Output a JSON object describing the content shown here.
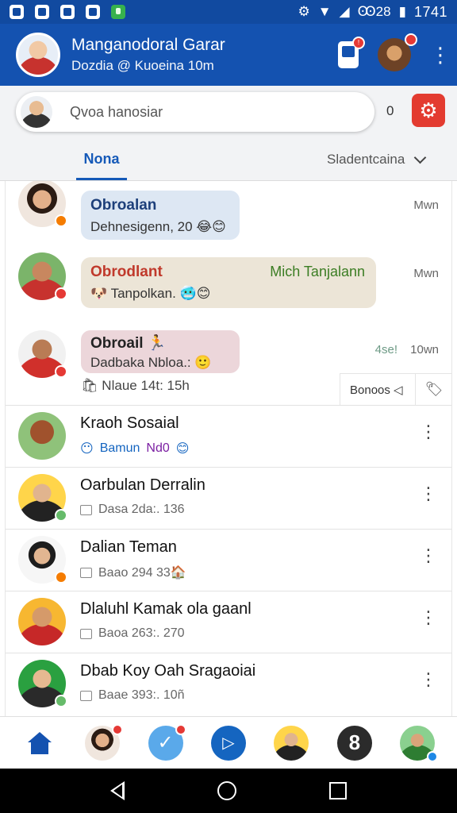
{
  "status_bar": {
    "time": "1741",
    "signal_text": "Ꙭ28"
  },
  "header": {
    "title": "Manganodoral Garar",
    "subtitle": "Dozdia @ Kuoeina 10m",
    "notification_badge": "!",
    "icons": [
      "phone-icon",
      "profile-avatar",
      "more-vert-icon"
    ]
  },
  "search": {
    "placeholder": "Qvoa hanosiar",
    "count": "0"
  },
  "tabs": {
    "active": "Nona",
    "dropdown": "Sladentcaina"
  },
  "feed": {
    "bubbles": [
      {
        "title": "Obroalan",
        "text": "Dehnesigenn, 20 😂😊",
        "time": "Mwn"
      },
      {
        "title": "Obrodlant",
        "alt_title": "Mich Tanjalann",
        "text": "🐶 Tanpolkan. 🥶😊",
        "time": "Mwn"
      },
      {
        "title": "Obroail 🏃",
        "text": "Dadbaka Nbloa.: 🙂",
        "time_alt": "4se!",
        "time": "10wn",
        "sub": "🛍 Nlaue 14t: 15h",
        "chip_label": "Bonoos ◁",
        "chip_icon": "🏷"
      }
    ],
    "list": [
      {
        "name": "Kraoh Sosaial",
        "sub_a": "Bamun",
        "sub_b": "Nd0",
        "emoji": "😊"
      },
      {
        "name": "Oarbulan Derralin",
        "sub": "Dasa 2da:. 136"
      },
      {
        "name": "Dalian Teman",
        "sub": "Baao 294 33🏠"
      },
      {
        "name": "Dlaluhl Kamak ola gaanl",
        "sub": "Baoa 263:. 270"
      },
      {
        "name": "Dbab Koy Oah Sragaoiai",
        "sub": "Baae 393:. 10ñ"
      }
    ]
  },
  "bottom_nav": [
    "home",
    "profile",
    "check",
    "play",
    "profile",
    "eight",
    "profile"
  ],
  "colors": {
    "primary": "#1452b0",
    "accent_red": "#e33b30",
    "active_tab": "#1559b8"
  }
}
